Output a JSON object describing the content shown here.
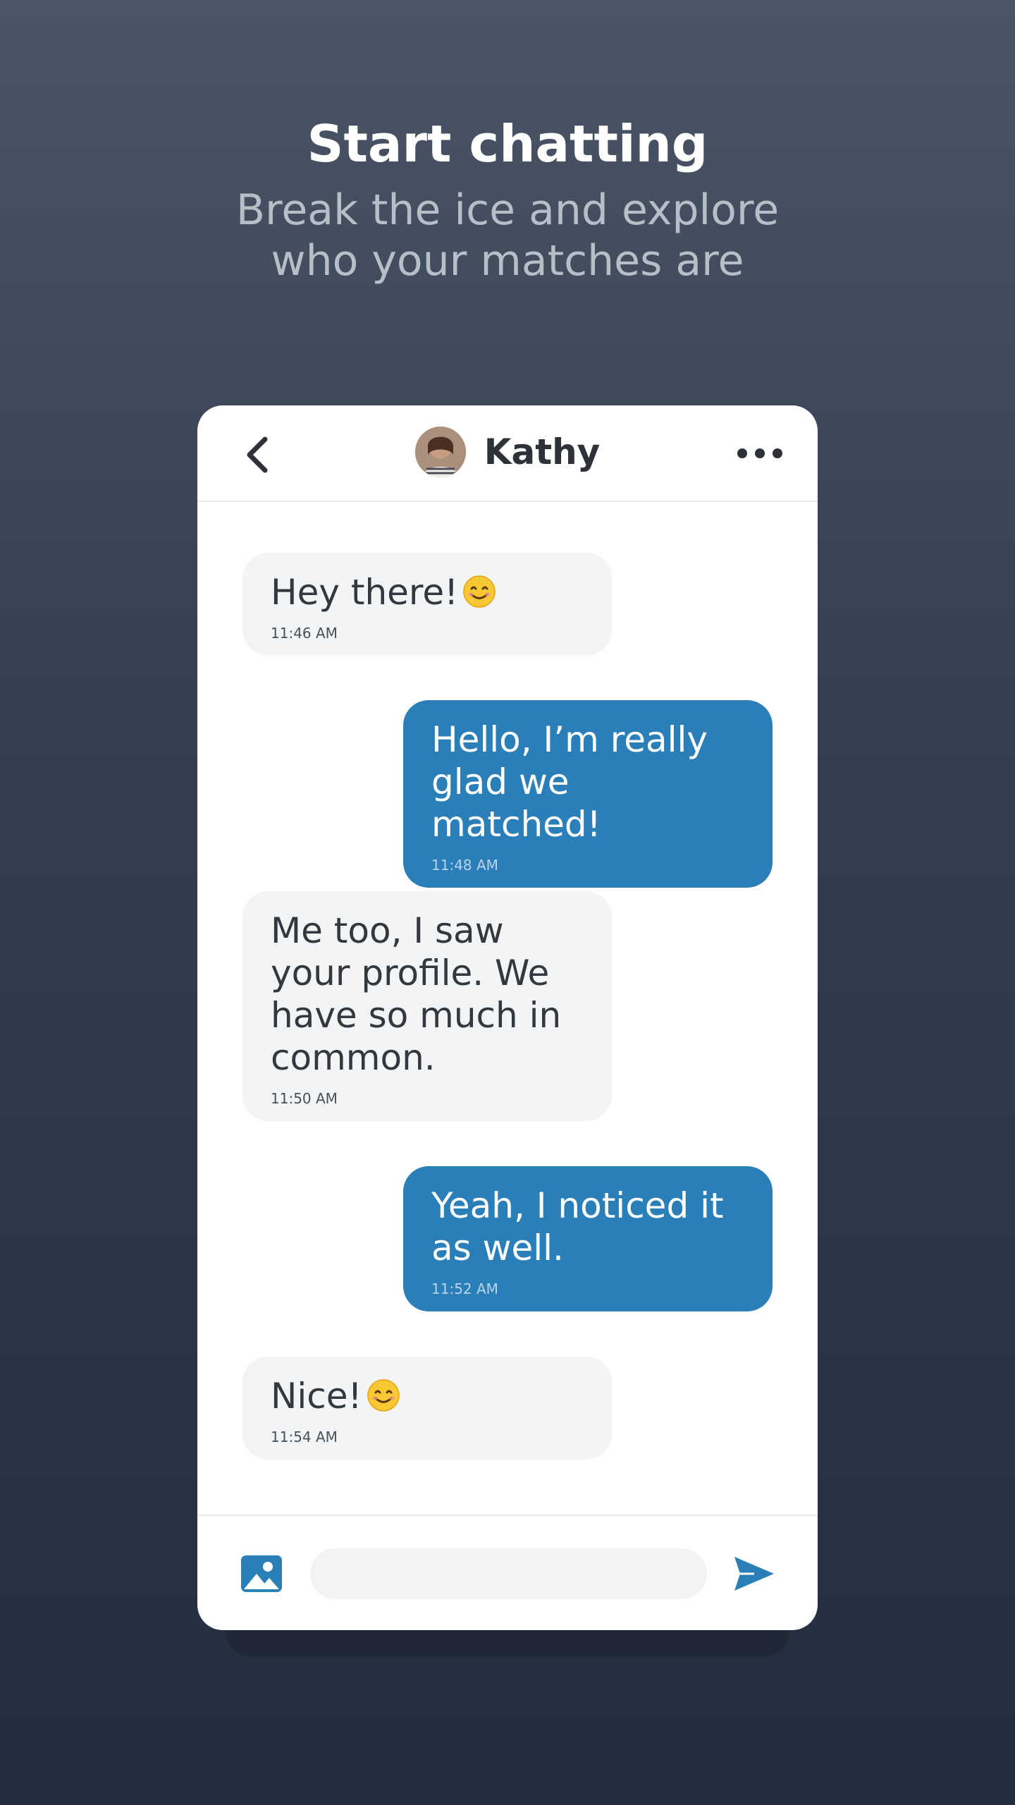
{
  "hero": {
    "title": "Start chatting",
    "subtitle": "Break the ice and explore who your matches are"
  },
  "chat": {
    "contact_name": "Kathy",
    "messages": [
      {
        "direction": "in",
        "text": "Hey there!",
        "emoji": "smiling-face-emoji",
        "time": "11:46 AM"
      },
      {
        "direction": "out",
        "text": "Hello, I’m really glad we matched!",
        "time": "11:48 AM"
      },
      {
        "direction": "in",
        "text": "Me too, I saw your profile. We have so much in common.",
        "time": "11:50 AM"
      },
      {
        "direction": "out",
        "text": "Yeah, I noticed it as well.",
        "time": "11:52 AM"
      },
      {
        "direction": "in",
        "text": "Nice!",
        "emoji": "smiling-face-emoji",
        "time": "11:54 AM"
      }
    ],
    "composer": {
      "value": "",
      "placeholder": ""
    },
    "icons": {
      "back": "chevron-left-icon",
      "more": "more-horizontal-icon",
      "photo": "image-icon",
      "send": "send-icon"
    }
  },
  "colors": {
    "accent": "#2b7fb8",
    "incoming_bubble": "#f3f4f6",
    "background_top": "#4a5566",
    "background_bottom": "#222d3d"
  }
}
